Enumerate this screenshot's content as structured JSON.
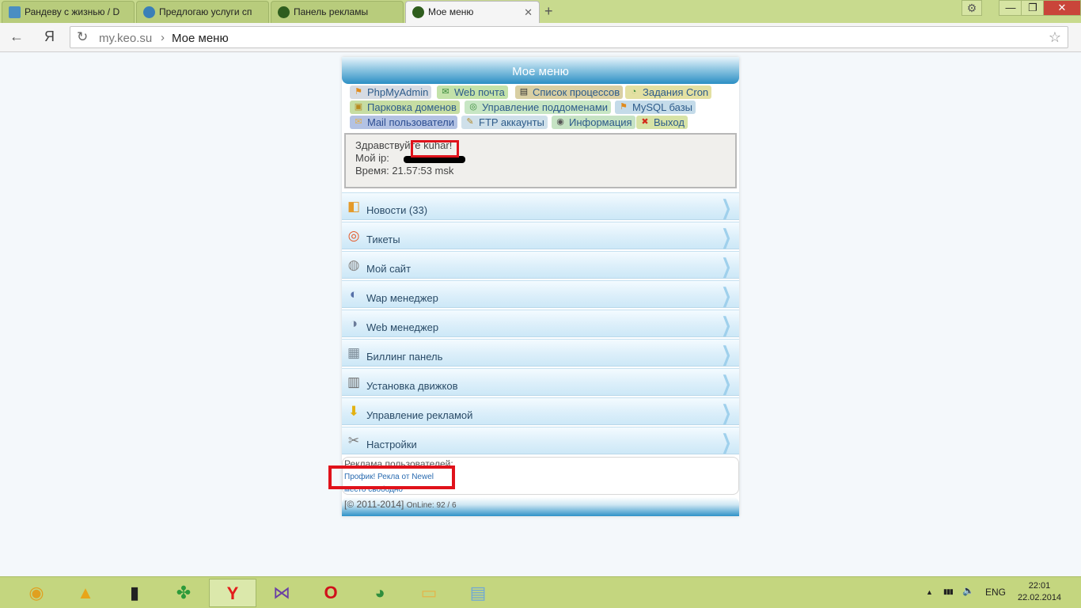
{
  "browser": {
    "tabs": [
      {
        "label": "Рандеву с жизнью / D",
        "favicon_color": "#4a8ec2"
      },
      {
        "label": "Предлогаю услуги сп",
        "favicon_color": "#3a7fb8"
      },
      {
        "label": "Панель рекламы",
        "favicon_color": "#2f5d1e"
      },
      {
        "label": "Мое меню",
        "favicon_color": "#2f5d1e",
        "active": true
      }
    ],
    "new_tab": "+",
    "window_controls": {
      "minimize": "—",
      "maximize": "❐",
      "close": "✕",
      "settings": "⚙"
    },
    "back_icon": "←",
    "yandex_icon": "Я",
    "reload_icon": "↻",
    "address": {
      "domain": "my.keo.su",
      "separator": "›",
      "title": "Мое меню"
    },
    "star_icon": "☆"
  },
  "page": {
    "header_title": "Мое меню",
    "links": [
      {
        "label": "PhpMyAdmin",
        "icon": "pma-icon",
        "glyph": "⚑",
        "bg": "#d6dbe3",
        "color": "#2d5b8a"
      },
      {
        "label": "Web почта",
        "icon": "mail-icon",
        "glyph": "✉",
        "bg": "#c3e2a9",
        "color": "#2d5b8a"
      },
      {
        "label": "Список процессов",
        "icon": "terminal-icon",
        "glyph": "▤",
        "bg": "#d9cfa3",
        "color": "#2d5b8a"
      },
      {
        "label": "Задания Cron",
        "icon": "clock-icon",
        "glyph": "◔",
        "bg": "#e3e0a2",
        "color": "#2d5b8a"
      },
      {
        "label": "Парковка доменов",
        "icon": "domain-icon",
        "glyph": "▣",
        "bg": "#c6dda3",
        "color": "#2d5b8a"
      },
      {
        "label": "Управление поддоменами",
        "icon": "subdomain-icon",
        "glyph": "◎",
        "bg": "#c7e6c4",
        "color": "#2d5b8a"
      },
      {
        "label": "MySQL базы",
        "icon": "mysql-icon",
        "glyph": "⚑",
        "bg": "#c4dbe9",
        "color": "#2d5b8a"
      },
      {
        "label": "Mail пользователи",
        "icon": "mail-users-icon",
        "glyph": "✉",
        "bg": "#b3c2e3",
        "color": "#2d4e92"
      },
      {
        "label": "FTP аккаунты",
        "icon": "ftp-icon",
        "glyph": "✎",
        "bg": "#cfe0ea",
        "color": "#2d5b8a"
      },
      {
        "label": "Информация",
        "icon": "info-icon",
        "glyph": "◉",
        "bg": "#c6e3c4",
        "color": "#2d5b8a"
      },
      {
        "label": "Выход",
        "icon": "exit-icon",
        "glyph": "✖",
        "bg": "#d7e3a6",
        "color": "#2d5b8a"
      }
    ],
    "info": {
      "greeting_prefix": "Здравствуйте",
      "username": "kuhar!",
      "ip_label": "Мой ip:",
      "time_line": "Время: 21.57:53 msk"
    },
    "menu": [
      {
        "label": "Новости (33)",
        "icon": "news-icon",
        "glyph": "◧",
        "color": "#e49a2a"
      },
      {
        "label": "Тикеты",
        "icon": "lifebuoy-icon",
        "glyph": "◎",
        "color": "#e55a2a"
      },
      {
        "label": "Мой сайт",
        "icon": "site-icon",
        "glyph": "◍",
        "color": "#8a8a8a"
      },
      {
        "label": "Wap менеджер",
        "icon": "wap-icon",
        "glyph": "◐",
        "color": "#5670a8"
      },
      {
        "label": "Web менеджер",
        "icon": "web-icon",
        "glyph": "◑",
        "color": "#6b7c9a"
      },
      {
        "label": "Биллинг панель",
        "icon": "billing-icon",
        "glyph": "▦",
        "color": "#7b8a96"
      },
      {
        "label": "Установка движков",
        "icon": "install-icon",
        "glyph": "▥",
        "color": "#6a6a6a"
      },
      {
        "label": "Управление рекламой",
        "icon": "ads-download-icon",
        "glyph": "⬇",
        "color": "#e3b112"
      },
      {
        "label": "Настройки",
        "icon": "settings-icon",
        "glyph": "✂",
        "color": "#7a7a7a"
      }
    ],
    "menu_arrow": "❯",
    "ads": {
      "title": "Реклама пользователей:",
      "link": "Профик! Рекла от Newel",
      "free": "место свободно"
    },
    "footer": {
      "copyright": "[© 2011-2014]",
      "online": "OnLine: 92 / 6"
    }
  },
  "taskbar": {
    "apps": [
      {
        "name": "taskbar-app-aimp",
        "glyph": "◉",
        "color": "#e0a020"
      },
      {
        "name": "taskbar-app-aimp-2",
        "glyph": "▲",
        "color": "#e8a51a"
      },
      {
        "name": "taskbar-app-terminal",
        "glyph": "▮",
        "color": "#222"
      },
      {
        "name": "taskbar-app-clover",
        "glyph": "✤",
        "color": "#2c9a3a"
      },
      {
        "name": "taskbar-app-yandex",
        "glyph": "Y",
        "color": "#e31b1b"
      },
      {
        "name": "taskbar-app-visualstudio",
        "glyph": "⋈",
        "color": "#6a3fa5"
      },
      {
        "name": "taskbar-app-opera",
        "glyph": "O",
        "color": "#d0111b"
      },
      {
        "name": "taskbar-app-chrome",
        "glyph": "◕",
        "color": "#2f8e3d"
      },
      {
        "name": "taskbar-app-explorer",
        "glyph": "▭",
        "color": "#e3b54a"
      },
      {
        "name": "taskbar-app-notepad",
        "glyph": "▤",
        "color": "#6ea7d6"
      }
    ],
    "tray": {
      "arrow": "▲",
      "signal": "▮▮▮",
      "volume": "🔈",
      "language": "ENG"
    },
    "clock": {
      "time": "22:01",
      "date": "22.02.2014"
    }
  }
}
